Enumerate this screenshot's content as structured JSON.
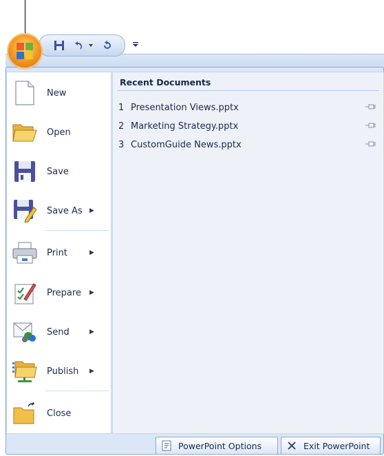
{
  "recent": {
    "title": "Recent Documents",
    "items": [
      {
        "num": "1",
        "name": "Presentation Views.pptx"
      },
      {
        "num": "2",
        "name": "Marketing Strategy.pptx"
      },
      {
        "num": "3",
        "name": "CustomGuide News.pptx"
      }
    ]
  },
  "menu": {
    "items": [
      {
        "label": "New",
        "icon": "new-document-icon"
      },
      {
        "label": "Open",
        "icon": "open-folder-icon"
      },
      {
        "label": "Save",
        "icon": "save-disk-icon"
      },
      {
        "label": "Save As",
        "icon": "save-as-icon",
        "submenu": true
      },
      {
        "label": "Print",
        "icon": "printer-icon",
        "submenu": true
      },
      {
        "label": "Prepare",
        "icon": "prepare-icon",
        "submenu": true
      },
      {
        "label": "Send",
        "icon": "send-icon",
        "submenu": true
      },
      {
        "label": "Publish",
        "icon": "publish-icon",
        "submenu": true
      },
      {
        "label": "Close",
        "icon": "close-folder-icon"
      }
    ]
  },
  "footer": {
    "options_label": "PowerPoint Options",
    "exit_label": "Exit PowerPoint"
  },
  "colors": {
    "accent": "#f7a02a",
    "frame": "#dbe7f7",
    "text": "#1a2a4e"
  }
}
